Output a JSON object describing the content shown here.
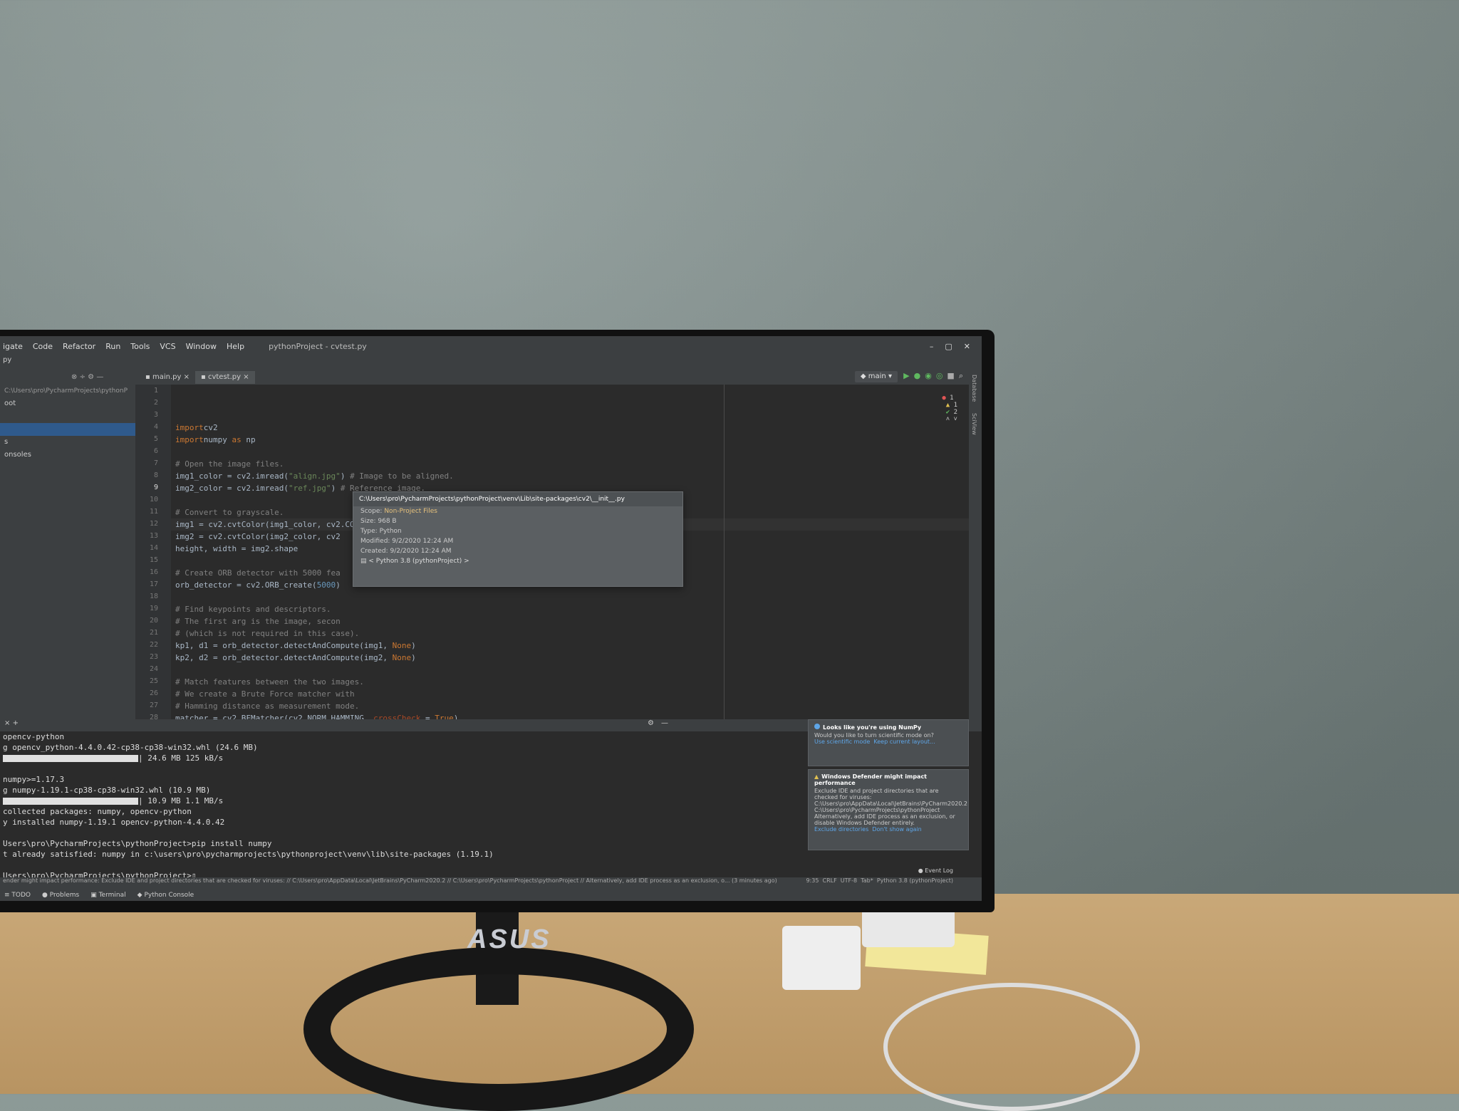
{
  "menu": {
    "items": [
      "igate",
      "Code",
      "Refactor",
      "Run",
      "Tools",
      "VCS",
      "Window",
      "Help"
    ],
    "title": "pythonProject - cvtest.py"
  },
  "toolbar": {
    "breadcrumb": "py"
  },
  "tabs": [
    {
      "label": "main.py"
    },
    {
      "label": "cvtest.py"
    }
  ],
  "run_config": "main",
  "project": {
    "path": "C:\\Users\\pro\\PycharmProjects\\pythonP",
    "items": [
      "oot",
      "",
      "",
      "s",
      "onsoles"
    ]
  },
  "editor": {
    "inspections": {
      "errors": "1",
      "warnings": "1",
      "weak": "2"
    },
    "current_line": 9,
    "lines": [
      {
        "n": "1",
        "t": [
          [
            "kw",
            "import"
          ],
          [
            "",
            "cv2"
          ]
        ]
      },
      {
        "n": "2",
        "t": [
          [
            "kw",
            "import"
          ],
          [
            "",
            "numpy "
          ],
          [
            "kw",
            "as"
          ],
          [
            "",
            " np"
          ]
        ]
      },
      {
        "n": "3",
        "t": []
      },
      {
        "n": "4",
        "t": [
          [
            "cm",
            "# Open the image files."
          ]
        ]
      },
      {
        "n": "5",
        "t": [
          [
            "",
            "img1_color = cv2.imread("
          ],
          [
            "str",
            "\"align.jpg\""
          ],
          [
            "",
            ") "
          ],
          [
            "cm",
            "# Image to be aligned."
          ]
        ]
      },
      {
        "n": "6",
        "t": [
          [
            "",
            "img2_color = cv2.imread("
          ],
          [
            "str",
            "\"ref.jpg\""
          ],
          [
            "",
            ") "
          ],
          [
            "cm",
            "# Reference image."
          ]
        ]
      },
      {
        "n": "7",
        "t": []
      },
      {
        "n": "8",
        "t": [
          [
            "cm",
            "# Convert to grayscale."
          ]
        ]
      },
      {
        "n": "9",
        "t": [
          [
            "",
            "img1 = cv2.cvtColor(img1_color, cv2.COLOR_BGR2GRAY)"
          ]
        ]
      },
      {
        "n": "10",
        "t": [
          [
            "",
            "img2 = cv2.cvtColor(img2_color, cv2"
          ]
        ]
      },
      {
        "n": "11",
        "t": [
          [
            "",
            "height, width = img2.shape"
          ]
        ]
      },
      {
        "n": "12",
        "t": []
      },
      {
        "n": "13",
        "t": [
          [
            "cm",
            "# Create ORB detector with 5000 fea"
          ]
        ]
      },
      {
        "n": "14",
        "t": [
          [
            "",
            "orb_detector = cv2.ORB_create("
          ],
          [
            "num",
            "5000"
          ],
          [
            "",
            ")"
          ]
        ]
      },
      {
        "n": "15",
        "t": []
      },
      {
        "n": "16",
        "t": [
          [
            "cm",
            "# Find keypoints and descriptors."
          ]
        ]
      },
      {
        "n": "17",
        "t": [
          [
            "cm",
            "# The first arg is the image, secon"
          ]
        ]
      },
      {
        "n": "18",
        "t": [
          [
            "cm",
            "# (which is not required in this case)."
          ]
        ]
      },
      {
        "n": "19",
        "t": [
          [
            "",
            "kp1, d1 = orb_detector.detectAndCompute(img1, "
          ],
          [
            "kw",
            "None"
          ],
          [
            "",
            ")"
          ]
        ]
      },
      {
        "n": "20",
        "t": [
          [
            "",
            "kp2, d2 = orb_detector.detectAndCompute(img2, "
          ],
          [
            "kw",
            "None"
          ],
          [
            "",
            ")"
          ]
        ]
      },
      {
        "n": "21",
        "t": []
      },
      {
        "n": "22",
        "t": [
          [
            "cm",
            "# Match features between the two images."
          ]
        ]
      },
      {
        "n": "23",
        "t": [
          [
            "cm",
            "# We create a Brute Force matcher with"
          ]
        ]
      },
      {
        "n": "24",
        "t": [
          [
            "cm",
            "# Hamming distance as measurement mode."
          ]
        ]
      },
      {
        "n": "25",
        "t": [
          [
            "",
            "matcher = cv2.BFMatcher(cv2.NORM_HAMMING, "
          ],
          [
            "param",
            "crossCheck"
          ],
          [
            "",
            " = "
          ],
          [
            "kw",
            "True"
          ],
          [
            "",
            ")"
          ]
        ]
      },
      {
        "n": "26",
        "t": []
      },
      {
        "n": "27",
        "t": [
          [
            "cm",
            "# Match the two sets of descriptors."
          ]
        ]
      },
      {
        "n": "28",
        "t": [
          [
            "",
            "matches = matcher.match(d1, d2)"
          ]
        ]
      }
    ]
  },
  "popup": {
    "path": "C:\\Users\\pro\\PycharmProjects\\pythonProject\\venv\\Lib\\site-packages\\cv2\\__init__.py",
    "scope_label": "Scope:",
    "scope": "Non-Project Files",
    "size": "Size: 968 B",
    "type": "Type: Python",
    "modified": "Modified: 9/2/2020 12:24 AM",
    "created": "Created: 9/2/2020 12:24 AM",
    "sdk": "< Python 3.8 (pythonProject) >"
  },
  "right_stripe": [
    "Database",
    "SciView"
  ],
  "terminal": {
    "tab_add": "+",
    "lines": [
      "opencv-python",
      "g opencv_python-4.4.0.42-cp38-cp38-win32.whl (24.6 MB)",
      "| 24.6 MB 125 kB/s",
      "",
      "numpy>=1.17.3",
      "g numpy-1.19.1-cp38-cp38-win32.whl (10.9 MB)",
      "| 10.9 MB 1.1 MB/s",
      "collected packages: numpy, opencv-python",
      "y installed numpy-1.19.1 opencv-python-4.4.0.42",
      "",
      "Users\\pro\\PycharmProjects\\pythonProject>pip install numpy",
      "t already satisfied: numpy in c:\\users\\pro\\pycharmprojects\\pythonproject\\venv\\lib\\site-packages (1.19.1)",
      "",
      "Users\\pro\\PycharmProjects\\pythonProject>"
    ]
  },
  "notifications": [
    {
      "title": "Looks like you're using NumPy",
      "body": "Would you like to turn scientific mode on?",
      "action1": "Use scientific mode",
      "action2": "Keep current layout..."
    },
    {
      "title": "Windows Defender might impact performance",
      "body": "Exclude IDE and project directories that are checked for viruses: C:\\Users\\pro\\AppData\\Local\\JetBrains\\PyCharm2020.2 C:\\Users\\pro\\PycharmProjects\\pythonProject Alternatively, add IDE process as an exclusion, or disable Windows Defender entirely.",
      "action1": "Exclude directories",
      "action2": "Don't show again"
    }
  ],
  "event_log": "Event Log",
  "status": {
    "message": "ender might impact performance: Exclude IDE and project directories that are checked for viruses: // C:\\Users\\pro\\AppData\\Local\\JetBrains\\PyCharm2020.2 // C:\\Users\\pro\\PycharmProjects\\pythonProject // Alternatively, add IDE process as an exclusion, o... (3 minutes ago)",
    "position": "9:35",
    "line_sep": "CRLF",
    "encoding": "UTF-8",
    "indent": "Tab*",
    "interpreter": "Python 3.8 (pythonProject)"
  },
  "toolwindows": [
    "TODO",
    "Problems",
    "Terminal",
    "Python Console"
  ],
  "brand": "ASUS"
}
